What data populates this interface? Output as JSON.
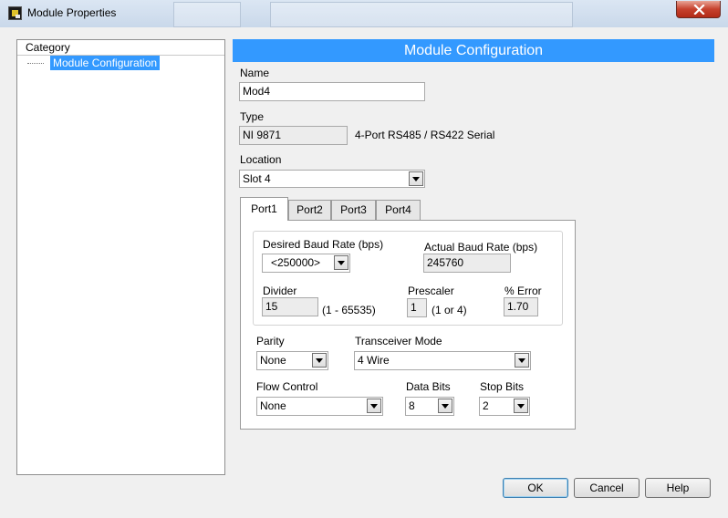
{
  "window": {
    "title": "Module Properties"
  },
  "category": {
    "header": "Category",
    "items": [
      {
        "label": "Module Configuration"
      }
    ]
  },
  "config": {
    "title": "Module Configuration",
    "name": {
      "label": "Name",
      "value": "Mod4"
    },
    "type": {
      "label": "Type",
      "value": "NI 9871",
      "description": "4-Port RS485 / RS422 Serial"
    },
    "location": {
      "label": "Location",
      "value": "Slot 4"
    }
  },
  "tabs": [
    {
      "label": "Port1"
    },
    {
      "label": "Port2"
    },
    {
      "label": "Port3"
    },
    {
      "label": "Port4"
    }
  ],
  "port": {
    "desired_baud": {
      "label": "Desired Baud Rate (bps)",
      "value": "<250000>"
    },
    "actual_baud": {
      "label": "Actual Baud Rate (bps)",
      "value": "245760"
    },
    "divider": {
      "label": "Divider",
      "value": "15",
      "range": "(1 - 65535)"
    },
    "prescaler": {
      "label": "Prescaler",
      "value": "1",
      "range": "(1 or 4)"
    },
    "error": {
      "label": "% Error",
      "value": "1.70"
    },
    "parity": {
      "label": "Parity",
      "value": "None"
    },
    "transceiver": {
      "label": "Transceiver Mode",
      "value": "4 Wire"
    },
    "flow_control": {
      "label": "Flow Control",
      "value": "None"
    },
    "data_bits": {
      "label": "Data Bits",
      "value": "8"
    },
    "stop_bits": {
      "label": "Stop Bits",
      "value": "2"
    }
  },
  "buttons": {
    "ok": "OK",
    "cancel": "Cancel",
    "help": "Help"
  },
  "colors": {
    "selection": "#3399ff",
    "close_button": "#c6412d",
    "dialog_bg": "#f0f0f0"
  }
}
